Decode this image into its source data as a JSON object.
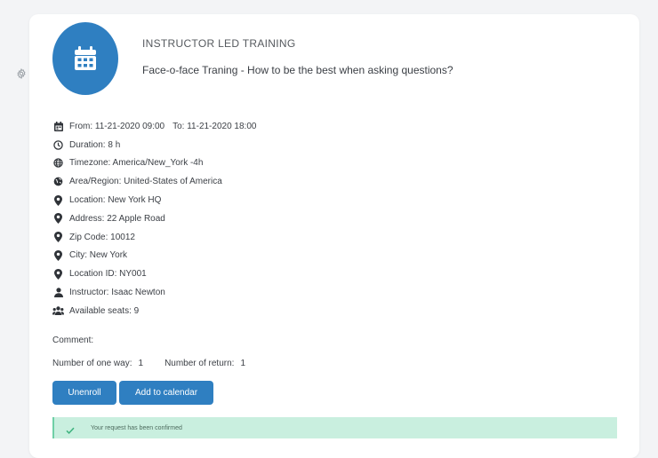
{
  "training": {
    "type_label": "INSTRUCTOR LED TRAINING",
    "title": "Face-o-face Traning - How to be the best when asking questions?"
  },
  "details": {
    "from": "From: 11-21-2020 09:00",
    "to": "To: 11-21-2020 18:00",
    "duration": "Duration: 8 h",
    "timezone": "Timezone: America/New_York -4h",
    "region": "Area/Region: United-States of America",
    "location": "Location: New York HQ",
    "address": "Address: 22 Apple Road",
    "zip": "Zip Code: 10012",
    "city": "City: New York",
    "location_id": "Location ID: NY001",
    "instructor": "Instructor: Isaac Newton",
    "seats": "Available seats: 9"
  },
  "comment_label": "Comment:",
  "counts": {
    "one_way_label": "Number of one way:",
    "one_way_value": "1",
    "return_label": "Number of return:",
    "return_value": "1"
  },
  "buttons": {
    "unenroll": "Unenroll",
    "add_calendar": "Add to calendar"
  },
  "alert": {
    "message": "Your request has been confirmed"
  },
  "icons": {
    "settings": "gear-icon",
    "badge": "calendar-icon",
    "date": "calendar-icon",
    "duration": "clock-icon",
    "timezone": "globe-icon",
    "region": "earth-icon",
    "location": "map-pin-icon",
    "instructor": "user-icon",
    "seats": "users-icon",
    "alert": "check-icon"
  },
  "colors": {
    "accent": "#2f7fc1",
    "alert_bg": "#c9efdf",
    "alert_check": "#3fb37f"
  }
}
